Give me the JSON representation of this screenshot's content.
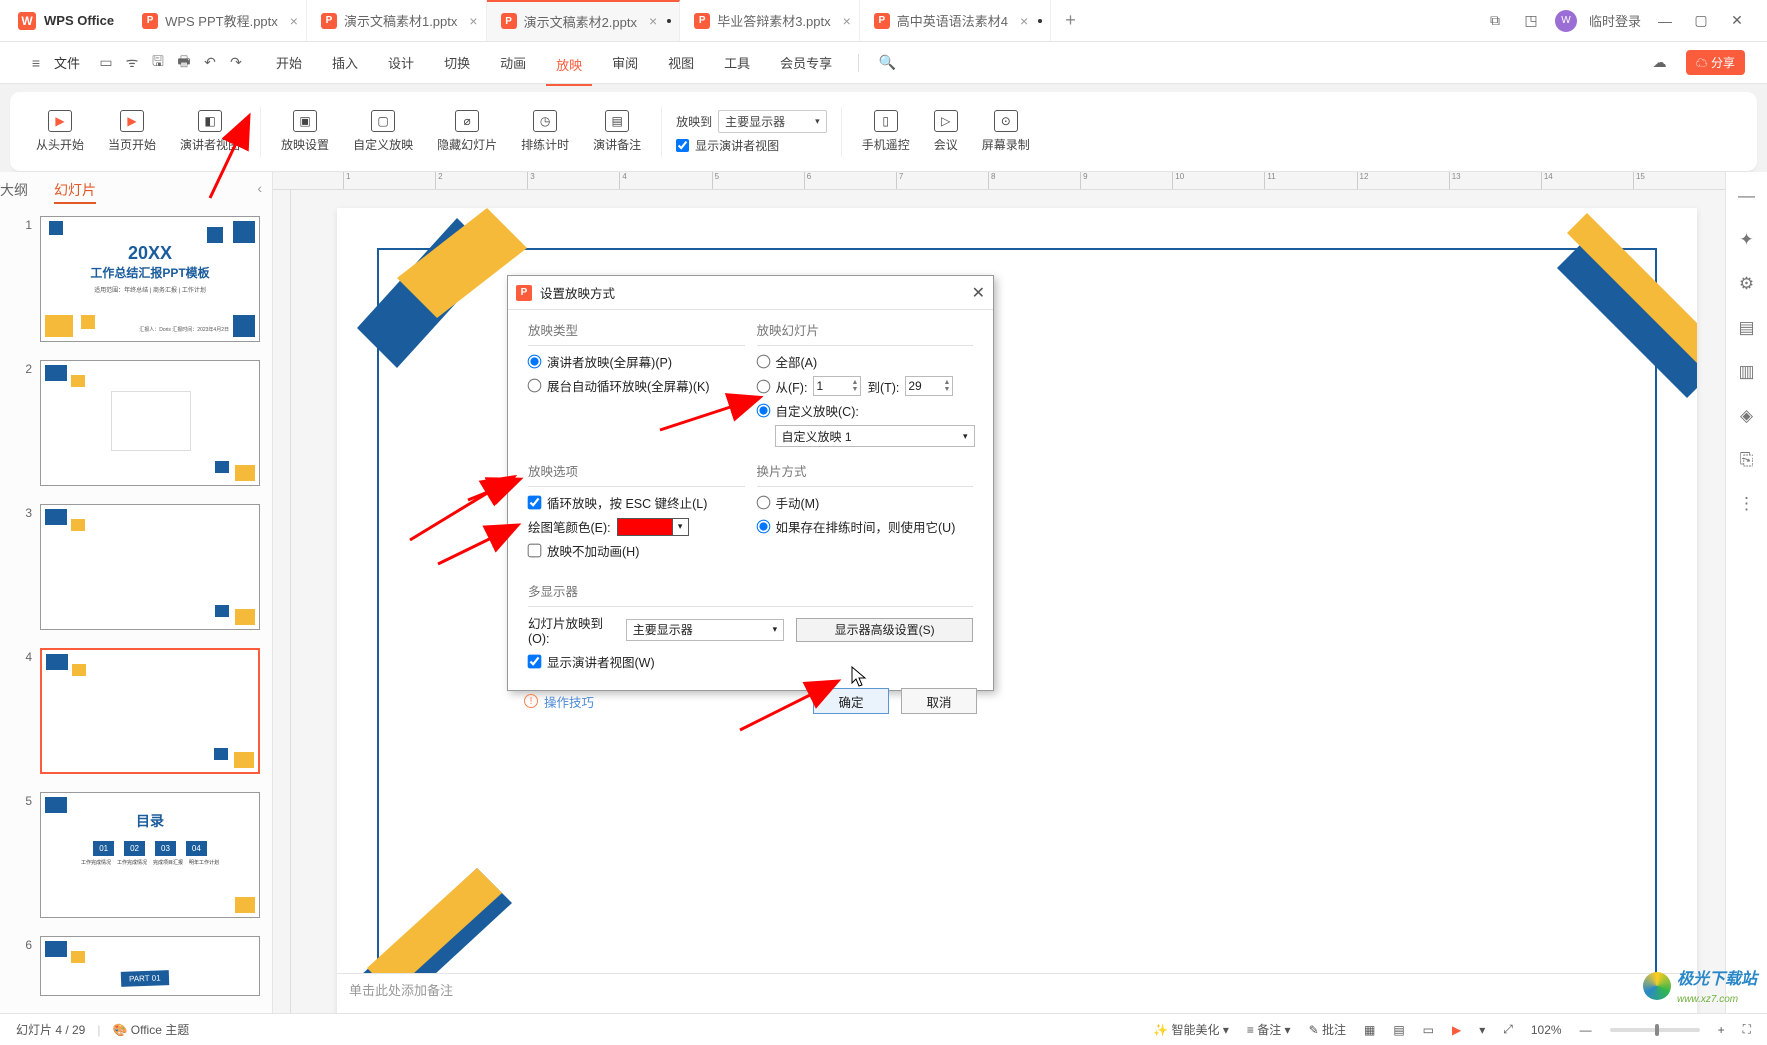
{
  "app": {
    "brand": "WPS Office",
    "logo": "W"
  },
  "tabs": [
    {
      "name": "WPS PPT教程.pptx",
      "active": false,
      "dirty": false
    },
    {
      "name": "演示文稿素材1.pptx",
      "active": false,
      "dirty": false
    },
    {
      "name": "演示文稿素材2.pptx",
      "active": true,
      "dirty": true
    },
    {
      "name": "毕业答辩素材3.pptx",
      "active": false,
      "dirty": false
    },
    {
      "name": "高中英语语法素材4",
      "active": false,
      "dirty": true
    }
  ],
  "top_right": {
    "login_text": "临时登录",
    "share": "分享"
  },
  "menu": {
    "file": "文件",
    "items": [
      "开始",
      "插入",
      "设计",
      "切换",
      "动画",
      "放映",
      "审阅",
      "视图",
      "工具",
      "会员专享"
    ],
    "active_index": 5
  },
  "ribbon": {
    "from_start": "从头开始",
    "from_current": "当页开始",
    "presenter_view": "演讲者视图",
    "show_settings": "放映设置",
    "custom_show": "自定义放映",
    "hide_slide": "隐藏幻灯片",
    "rehearse": "排练计时",
    "speaker_notes": "演讲备注",
    "project_to": "放映到",
    "monitor_value": "主要显示器",
    "show_presenter_chk": "显示演讲者视图",
    "phone_remote": "手机遥控",
    "meeting": "会议",
    "screen_record": "屏幕录制"
  },
  "side_tabs": {
    "outline": "大纲",
    "slides": "幻灯片",
    "active": "slides"
  },
  "thumbs": {
    "slide1_year": "20XX",
    "slide1_line1": "工作总结汇报PPT模板",
    "slide1_line2": "适用范围：年终总结 | 商务汇报 | 工作计划",
    "slide1_footer": "汇报人：Doris 汇报时间：2023年4月2日",
    "slide5_title": "目录",
    "slide5_items": [
      "01",
      "02",
      "03",
      "04"
    ],
    "slide5_labels": [
      "工作完成情况",
      "工作完成情况",
      "完成项目汇报",
      "明年工作计划"
    ],
    "slide6_part": "PART 01"
  },
  "notes_placeholder": "单击此处添加备注",
  "dialog": {
    "title": "设置放映方式",
    "groups": {
      "type": "放映类型",
      "range": "放映幻灯片",
      "options": "放映选项",
      "advance": "换片方式",
      "multi": "多显示器"
    },
    "type_presenter": "演讲者放映(全屏幕)(P)",
    "type_kiosk": "展台自动循环放映(全屏幕)(K)",
    "range_all": "全部(A)",
    "range_from_label": "从(F):",
    "range_from_val": "1",
    "range_to_label": "到(T):",
    "range_to_val": "29",
    "range_custom": "自定义放映(C):",
    "range_custom_val": "自定义放映 1",
    "opt_loop": "循环放映，按 ESC 键终止(L)",
    "opt_pen_color": "绘图笔颜色(E):",
    "opt_pen_color_val": "#ff0000",
    "opt_no_anim": "放映不加动画(H)",
    "adv_manual": "手动(M)",
    "adv_timing": "如果存在排练时间，则使用它(U)",
    "multi_label": "幻灯片放映到(O):",
    "multi_val": "主要显示器",
    "multi_adv_btn": "显示器高级设置(S)",
    "multi_presenter_chk": "显示演讲者视图(W)",
    "compat": "操作技巧",
    "ok": "确定",
    "cancel": "取消"
  },
  "status": {
    "slide_pos": "幻灯片 4 / 29",
    "theme": "Office 主题",
    "beautify": "智能美化",
    "notes_btn": "备注",
    "comments_btn": "批注",
    "zoom": "102%"
  },
  "watermark": {
    "text": "极光下载站",
    "url": "www.xz7.com"
  }
}
